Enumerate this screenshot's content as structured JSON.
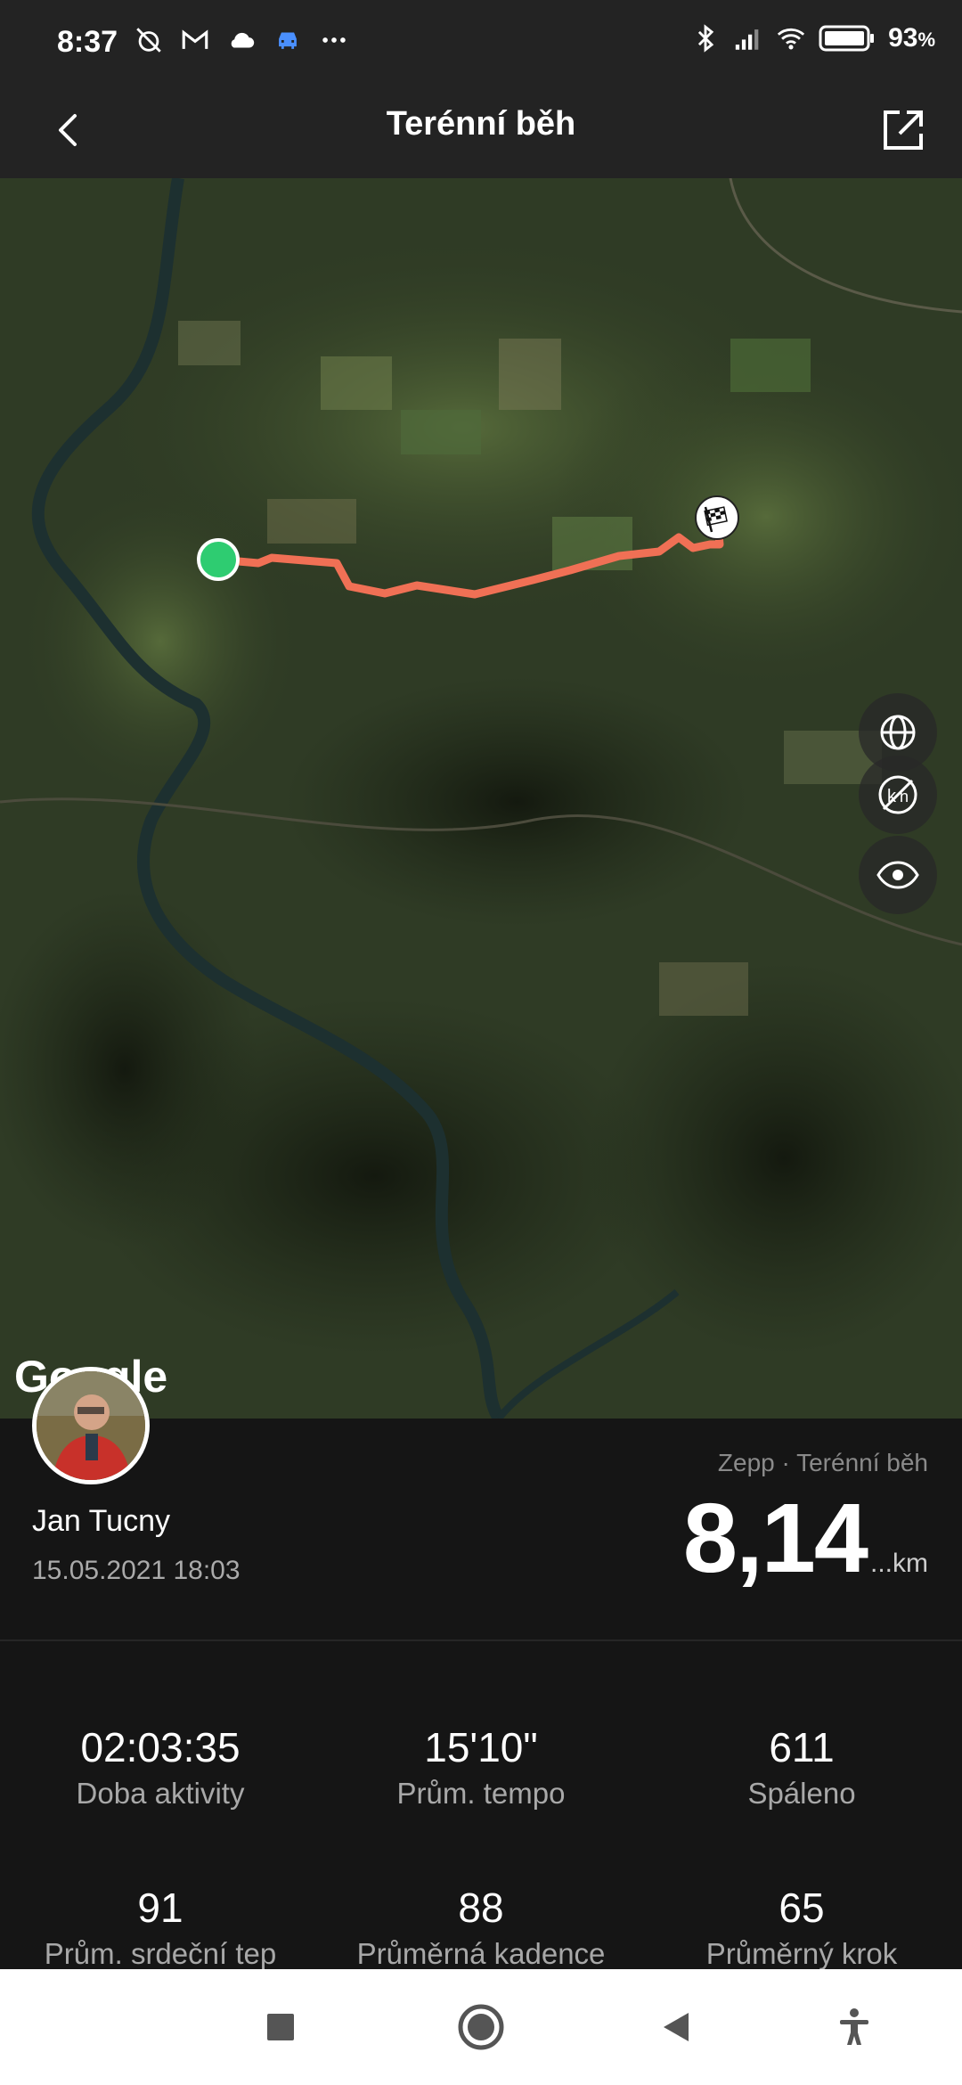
{
  "status_bar": {
    "time": "8:37",
    "battery_percent": "93",
    "battery_unit": "%"
  },
  "header": {
    "title": "Terénní běh"
  },
  "map": {
    "attribution": "Google",
    "route_color": "#f07055",
    "start_marker_color": "#2ecc71"
  },
  "summary": {
    "user_name": "Jan Tucny",
    "date": "15.05.2021 18:03",
    "source": "Zepp · Terénní běh",
    "distance": "8,14",
    "distance_unit": "...km"
  },
  "stats": [
    {
      "value": "02:03:35",
      "label": "Doba aktivity"
    },
    {
      "value": "15'10\"",
      "label": "Prům. tempo"
    },
    {
      "value": "611",
      "label": "Spáleno"
    },
    {
      "value": "91",
      "label": "Prům. srdeční tep"
    },
    {
      "value": "88",
      "label": "Průměrná kadence"
    },
    {
      "value": "65",
      "label": "Průměrný krok"
    }
  ]
}
